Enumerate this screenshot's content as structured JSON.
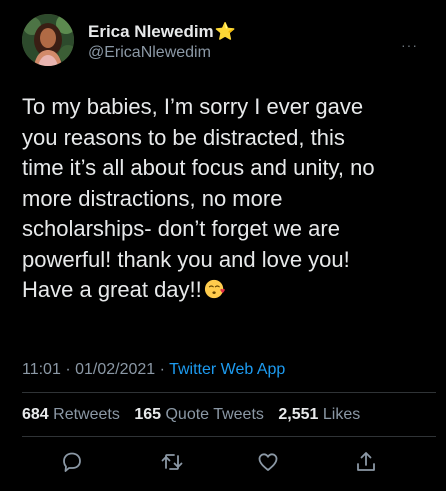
{
  "author": {
    "display_name": "Erica Nlewedim",
    "badge": "⭐",
    "handle": "@EricaNlewedim"
  },
  "menu_glyph": "···",
  "tweet": {
    "text": "To my babies, I’m sorry I ever gave\nyou reasons to be distracted, this\ntime it’s all about focus and unity, no\nmore distractions, no more\nscholarships- don’t forget we are\npowerful! thank you and love you!\nHave a great day!!",
    "emoji": "kissing-face-emoji"
  },
  "meta": {
    "time": "11:01",
    "separator": "·",
    "date": "01/02/2021",
    "source": "Twitter Web App"
  },
  "stats": {
    "retweets_count": "684",
    "retweets_label": "Retweets",
    "quotes_count": "165",
    "quotes_label": "Quote Tweets",
    "likes_count": "2,551",
    "likes_label": "Likes"
  },
  "actions": [
    "reply-icon",
    "retweet-icon",
    "like-icon",
    "share-icon"
  ],
  "colors": {
    "background": "#000000",
    "text": "#e7e9ea",
    "muted": "#8b98a5",
    "link": "#1d9bf0",
    "divider": "#2f3336",
    "icon": "#8b98a5"
  }
}
